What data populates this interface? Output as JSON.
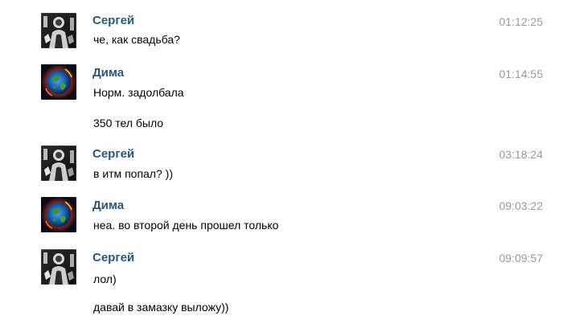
{
  "messages": [
    {
      "author": "Сергей",
      "avatar_icon": "bw-photo-avatar-icon",
      "time": "01:12:25",
      "lines": [
        "че, как свадьба?"
      ]
    },
    {
      "author": "Дима",
      "avatar_icon": "earth-fire-avatar-icon",
      "time": "01:14:55",
      "lines": [
        "Норм. задолбала",
        "350 тел было"
      ]
    },
    {
      "author": "Сергей",
      "avatar_icon": "bw-photo-avatar-icon",
      "time": "03:18:24",
      "lines": [
        "в итм попал? ))"
      ]
    },
    {
      "author": "Дима",
      "avatar_icon": "earth-fire-avatar-icon",
      "time": "09:03:22",
      "lines": [
        "неа. во второй день прошел только"
      ]
    },
    {
      "author": "Сергей",
      "avatar_icon": "bw-photo-avatar-icon",
      "time": "09:09:57",
      "lines": [
        "лол)",
        "давай в замазку выложу))"
      ]
    }
  ],
  "colors": {
    "author_name": "#2b587a",
    "timestamp": "#999999",
    "message_text": "#000000"
  }
}
